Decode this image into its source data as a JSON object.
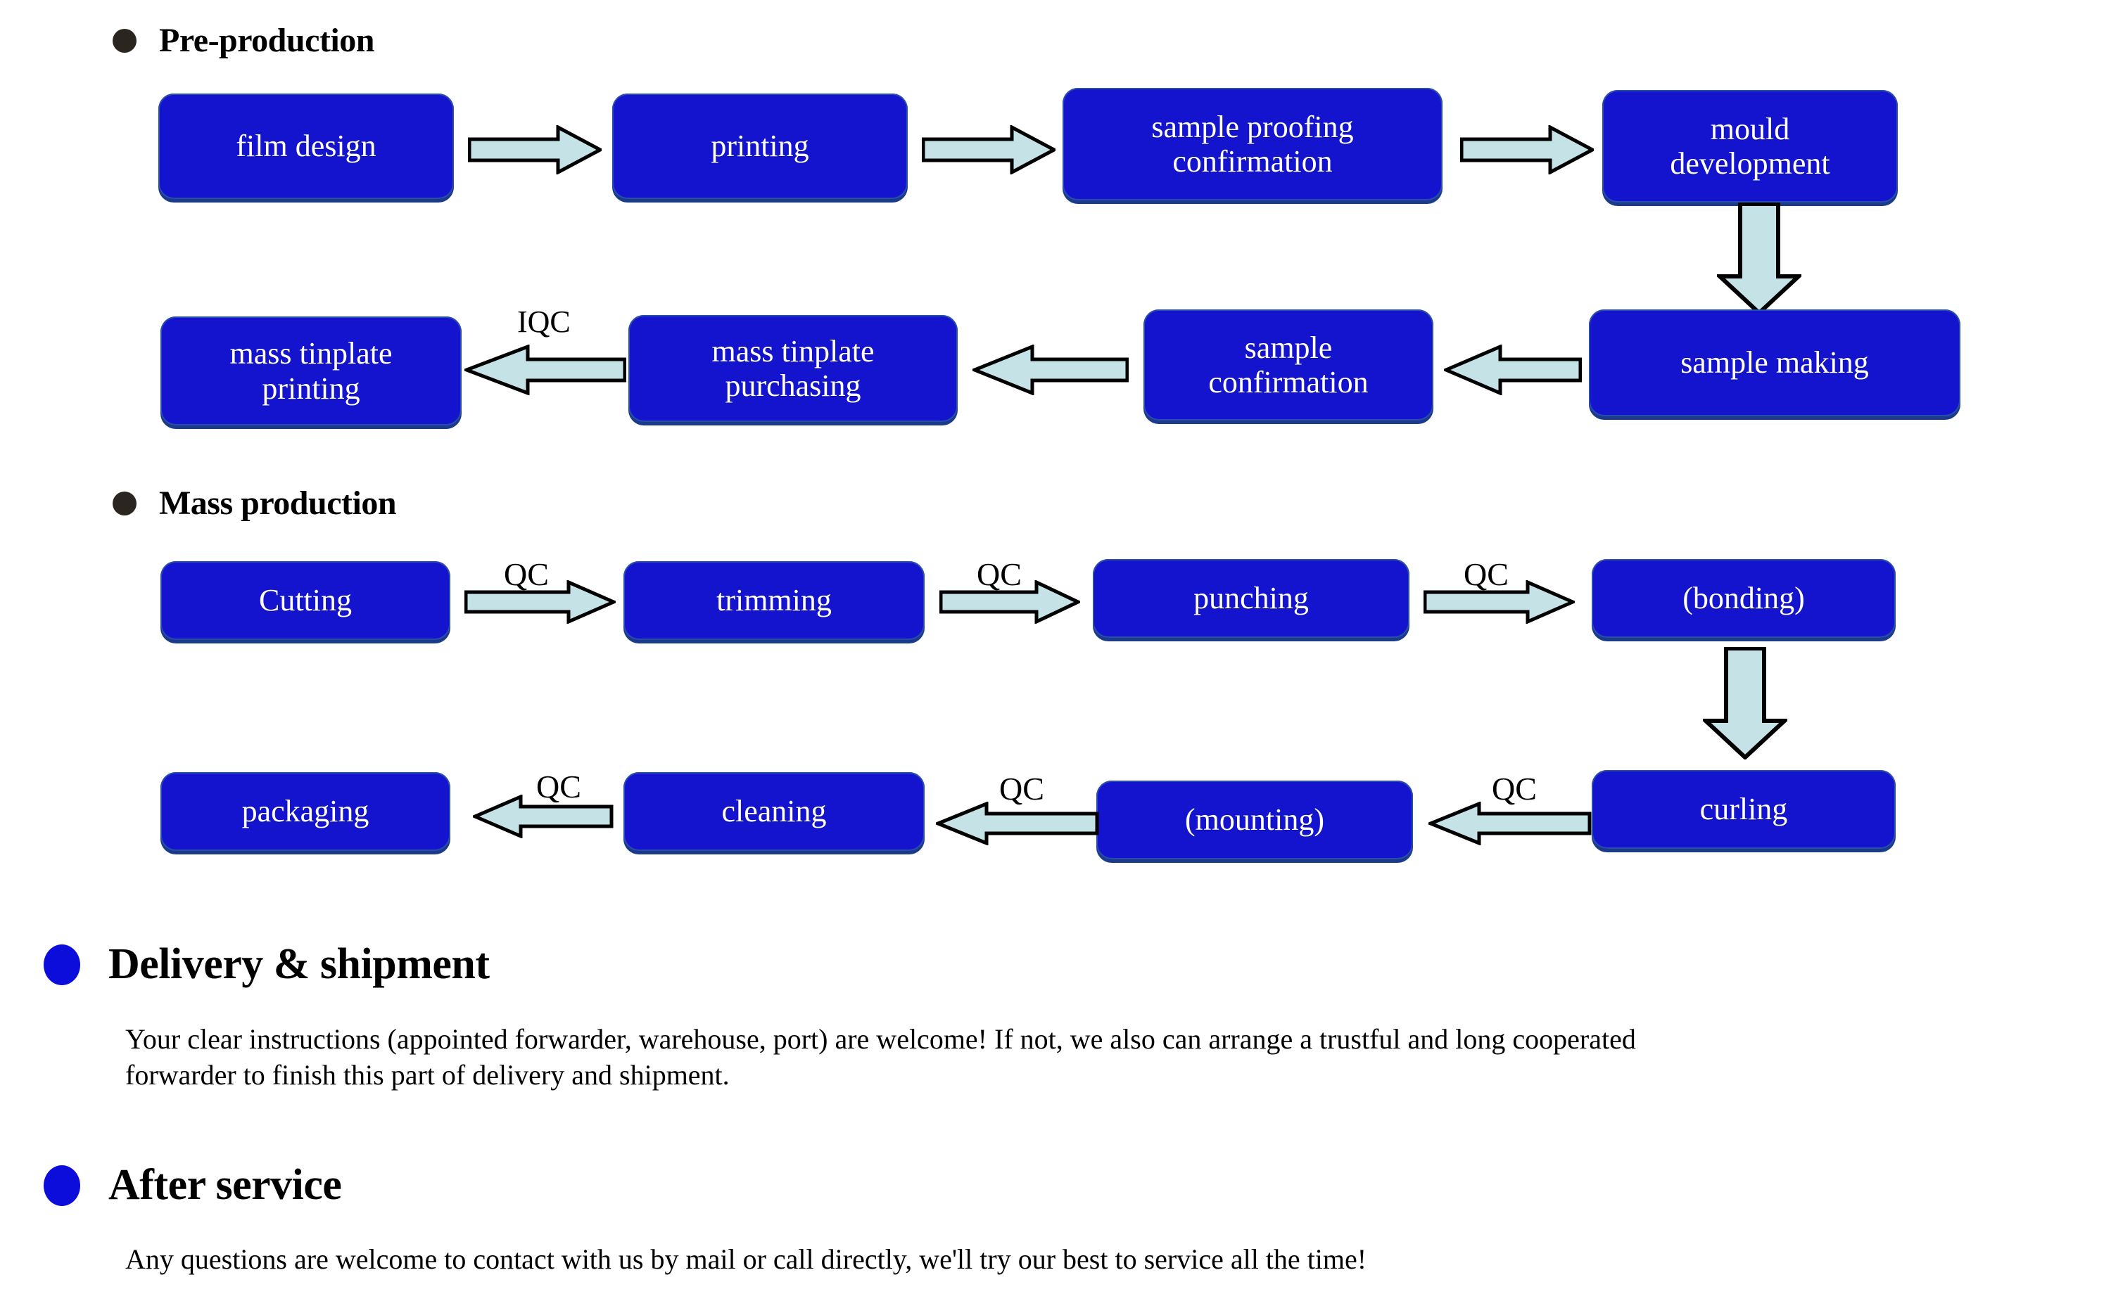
{
  "sections": {
    "preproduction": {
      "heading": "Pre-production",
      "bullet": "dark-dot-bullet",
      "row1": [
        {
          "label": "film design"
        },
        {
          "label": "printing"
        },
        {
          "label_line1": "sample proofing",
          "label_line2": "confirmation"
        },
        {
          "label_line1": "mould",
          "label_line2": "development"
        }
      ],
      "row2": [
        {
          "label_line1": "mass tinplate",
          "label_line2": "printing"
        },
        {
          "label_line1": "mass tinplate",
          "label_line2": "purchasing"
        },
        {
          "label_line1": "sample",
          "label_line2": "confirmation"
        },
        {
          "label": "sample making"
        }
      ],
      "arrow_labels": {
        "iqc": "IQC"
      }
    },
    "massproduction": {
      "heading": "Mass production",
      "bullet": "dark-dot-bullet",
      "row1": [
        {
          "label": "Cutting"
        },
        {
          "label": "trimming"
        },
        {
          "label": "punching"
        },
        {
          "label": "(bonding)"
        }
      ],
      "row2": [
        {
          "label": "packaging"
        },
        {
          "label": "cleaning"
        },
        {
          "label": "(mounting)"
        },
        {
          "label": "curling"
        }
      ],
      "arrow_labels": {
        "qc1": "QC",
        "qc2": "QC",
        "qc3": "QC",
        "qc4": "QC",
        "qc5": "QC",
        "qc6": "QC"
      }
    },
    "delivery": {
      "heading": "Delivery & shipment",
      "bullet": "blue-dot-bullet",
      "body_line1": "Your clear instructions (appointed forwarder, warehouse, port) are welcome!  If not, we also can arrange a trustful and long cooperated",
      "body_line2": "forwarder to finish this part of delivery and shipment."
    },
    "afterservice": {
      "heading": "After service",
      "bullet": "blue-dot-bullet",
      "body_line1": "Any questions are welcome to contact with us by mail or call directly, we'll try our best to service all the time!"
    }
  },
  "colors": {
    "box_fill": "#1414cf",
    "box_shadow": "#1a3a8a",
    "arrow_fill": "#c5e2e6",
    "arrow_stroke": "#000000",
    "bullet_dark": "#2b2520",
    "bullet_blue": "#0d0ddb",
    "box_text": "#ffffff",
    "page_bg": "#ffffff"
  }
}
